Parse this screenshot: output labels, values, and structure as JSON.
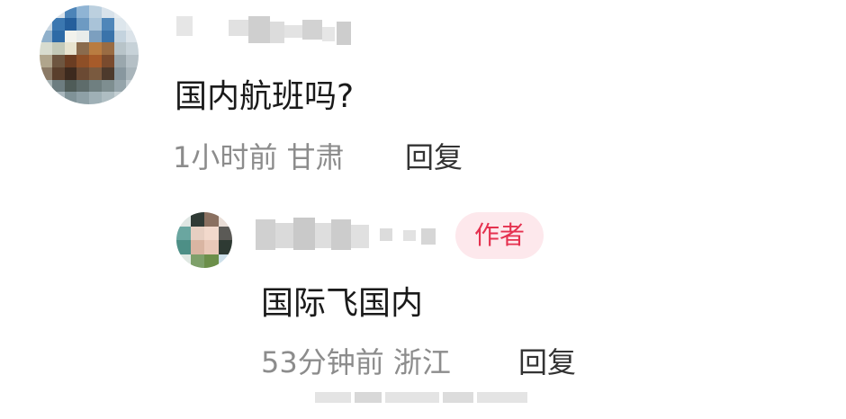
{
  "comment": {
    "text": "国内航班吗?",
    "time": "1小时前",
    "location": "甘肃",
    "reply_label": "回复"
  },
  "reply": {
    "text": "国际飞国内",
    "time": "53分钟前",
    "location": "浙江",
    "reply_label": "回复",
    "author_badge": "作者"
  },
  "colors": {
    "badge_bg": "#fde8ec",
    "badge_text": "#e5314f",
    "meta_text": "#8c8c8c"
  }
}
